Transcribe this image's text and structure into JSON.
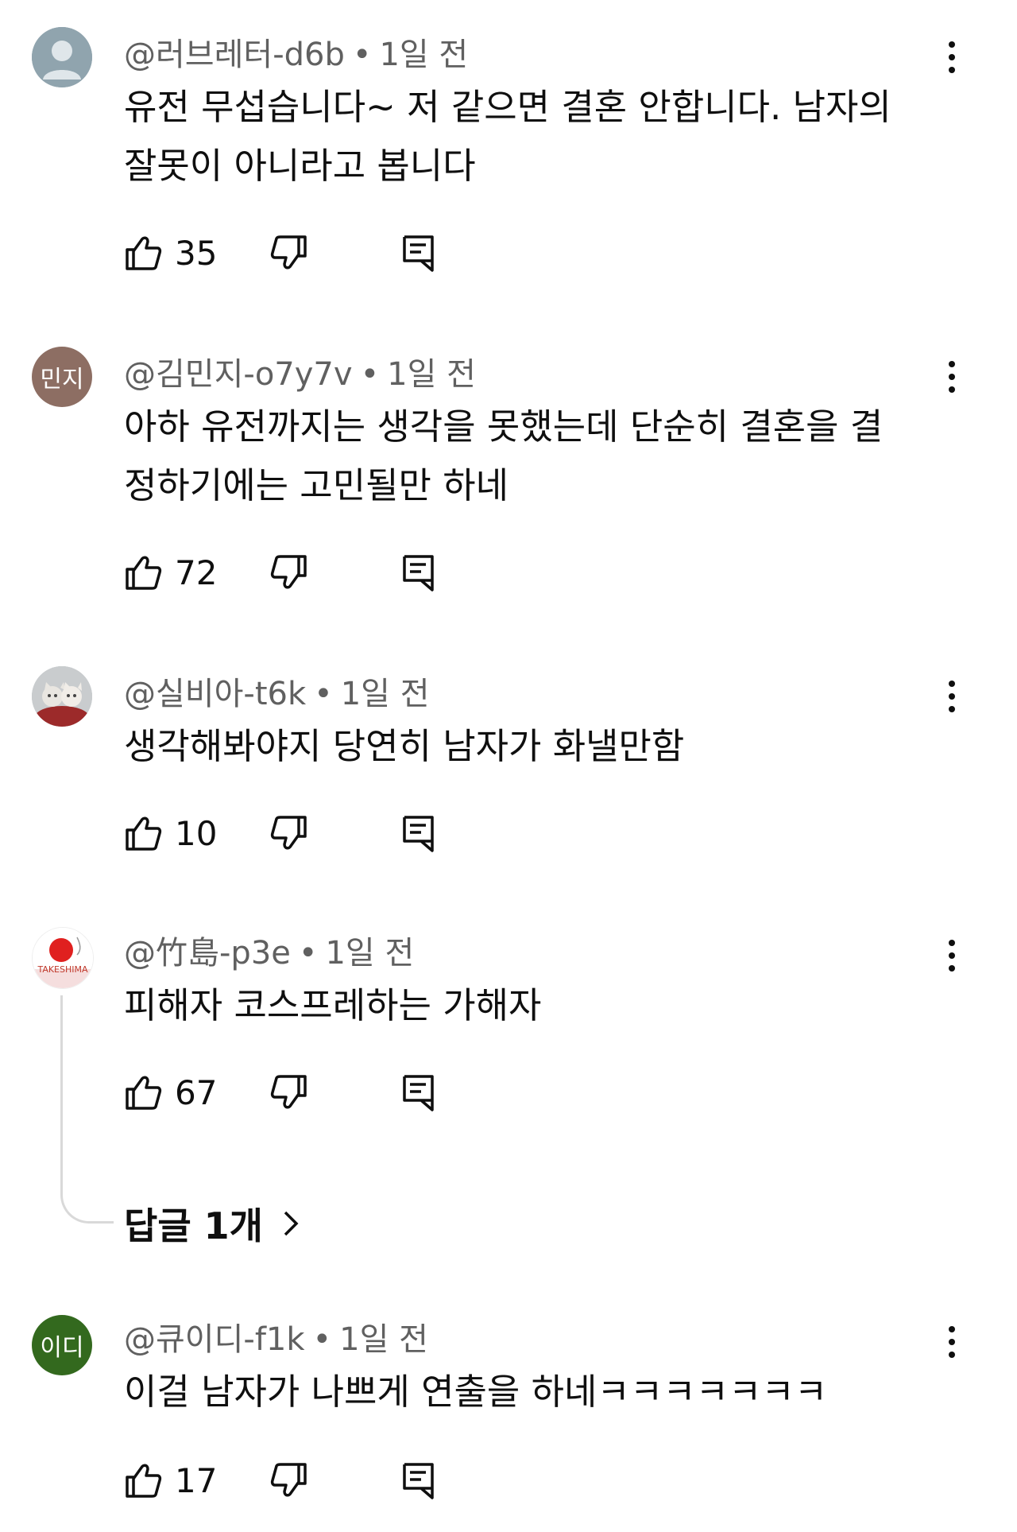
{
  "comments": [
    {
      "author": "@러브레터-d6b",
      "time": "1일 전",
      "text_lines": [
        "유전 무섭습니다~ 저 같으면 결혼 안합니다. 남자의",
        "잘못이 아니라고 봅니다"
      ],
      "likes": "35",
      "avatar": {
        "type": "default-person",
        "color": "#90a4ae"
      }
    },
    {
      "author": "@김민지-o7y7v",
      "time": "1일 전",
      "text_lines": [
        "아하 유전까지는 생각을 못했는데 단순히 결혼을 결",
        "정하기에는 고민될만 하네"
      ],
      "likes": "72",
      "avatar": {
        "type": "initials",
        "initials": "민지",
        "color": "#8d6e63"
      }
    },
    {
      "author": "@실비아-t6k",
      "time": "1일 전",
      "text_lines": [
        "생각해봐야지 당연히 남자가 화낼만함"
      ],
      "likes": "10",
      "avatar": {
        "type": "photo-kittens"
      }
    },
    {
      "author": "@竹島-p3e",
      "time": "1일 전",
      "text_lines": [
        "피해자 코스프레하는 가해자"
      ],
      "likes": "67",
      "avatar": {
        "type": "photo-flag",
        "caption": "TAKESHIMA"
      },
      "replies_label": "답글 1개"
    },
    {
      "author": "@큐이디-f1k",
      "time": "1일 전",
      "text_lines": [
        "이걸 남자가 나쁘게 연출을 하네ㅋㅋㅋㅋㅋㅋㅋ"
      ],
      "likes": "17",
      "avatar": {
        "type": "initials",
        "initials": "이디",
        "color": "#33691e"
      }
    }
  ],
  "separator": "•",
  "icons": {
    "like": "thumbs-up-icon",
    "dislike": "thumbs-down-icon",
    "reply": "reply-comment-icon",
    "more": "more-vertical-icon",
    "chevron": "chevron-right-icon"
  }
}
